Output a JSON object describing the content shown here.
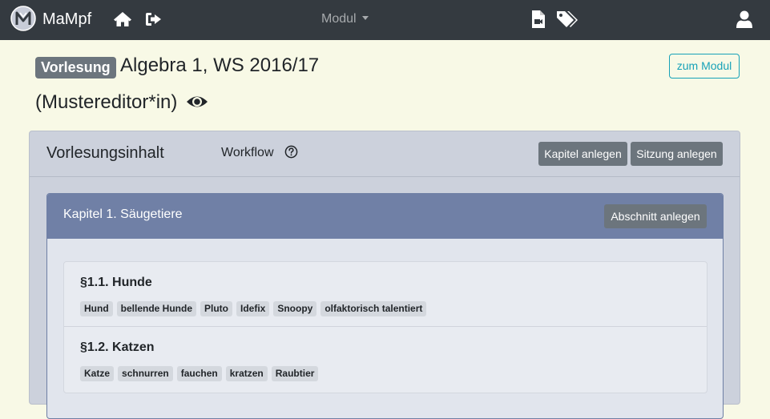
{
  "navbar": {
    "brand": "MaMpf",
    "modul_label": "Modul",
    "icons": {
      "logo": "mampf-logo",
      "home": "home-icon",
      "logout": "sign-out-icon",
      "file_video": "file-video-icon",
      "tags": "tags-icon",
      "user": "user-icon"
    }
  },
  "header": {
    "badge": "Vorlesung",
    "title": "Algebra 1, WS 2016/17",
    "subtitle": "(Mustereditor*in)",
    "to_module_label": "zum Modul"
  },
  "card": {
    "title": "Vorlesungsinhalt",
    "workflow_label": "Workflow",
    "buttons": {
      "add_chapter": "Kapitel anlegen",
      "add_session": "Sitzung anlegen"
    }
  },
  "chapter": {
    "title": "Kapitel 1. Säugetiere",
    "add_section_label": "Abschnitt anlegen",
    "sections": [
      {
        "title": "§1.1. Hunde",
        "tags": [
          "Hund",
          "bellende Hunde",
          "Pluto",
          "Idefix",
          "Snoopy",
          "olfaktorisch talentiert"
        ]
      },
      {
        "title": "§1.2. Katzen",
        "tags": [
          "Katze",
          "schnurren",
          "fauchen",
          "kratzen",
          "Raubtier"
        ]
      }
    ]
  },
  "colors": {
    "navbar": "#343a40",
    "page_bg": "#f8f9e6",
    "card_bg": "#ccd1dc",
    "chapter_header": "#7080a6",
    "secondary_button": "#6c757d",
    "outline_button": "#17a2b8"
  }
}
